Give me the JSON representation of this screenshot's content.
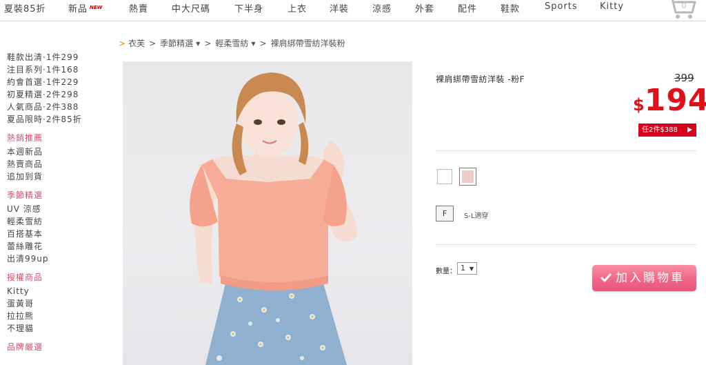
{
  "nav": {
    "items": [
      "夏裝85折",
      "新品",
      "熱賣",
      "中大尺碼",
      "下半身",
      "上衣",
      "洋裝",
      "涼感",
      "外套",
      "配件",
      "鞋款",
      "Sports",
      "Kitty"
    ],
    "new_tag": "NEW",
    "cart_count": "0"
  },
  "sidebar": {
    "top_items": [
      "鞋款出清·1件299",
      "注目系列·1件168",
      "約會首選·1件229",
      "初夏精選·2件298",
      "人氣商品·2件388",
      "夏品限時·2件85折"
    ],
    "groups": [
      {
        "title": "熱銷推薦",
        "items": [
          "本週新品",
          "熱賣商品",
          "追加到貨"
        ]
      },
      {
        "title": "季節精選",
        "items": [
          "UV 涼感",
          "輕柔雪紡",
          "百搭基本",
          "蕾絲雕花",
          "出清99up"
        ]
      },
      {
        "title": "授權商品",
        "items": [
          "Kitty",
          "蛋黃哥",
          "拉拉熊",
          "不理貓"
        ]
      },
      {
        "title": "品牌嚴選",
        "items": []
      }
    ]
  },
  "breadcrumb": {
    "home": "衣芙",
    "level1": "季節精選",
    "level2": "輕柔雪紡",
    "current": "裸肩綁帶雪紡洋裝粉"
  },
  "product": {
    "name": "裸肩綁帶雪紡洋裝 -粉F",
    "old_price": "399",
    "currency": "$",
    "price": "194",
    "promo": "任2件$388",
    "size": "F",
    "size_note": "S-L適穿",
    "qty_label": "數量：",
    "qty_value": "1",
    "add_to_cart": "加入購物車"
  },
  "colors": {
    "accent_red": "#e0111b",
    "sidebar_pink": "#d2506e",
    "button_pink": "#f26686",
    "swatch_pink": "#eccbc4"
  }
}
